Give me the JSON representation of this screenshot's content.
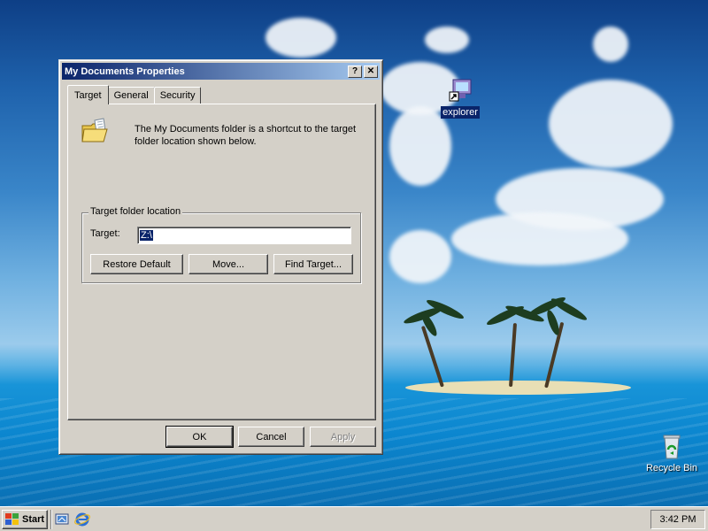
{
  "desktop": {
    "icons": [
      {
        "label": "explorer",
        "icon": "explorer-shortcut-icon",
        "selected": true
      },
      {
        "label": "Recycle Bin",
        "icon": "recycle-bin-icon",
        "selected": false
      }
    ]
  },
  "dialog": {
    "title": "My Documents Properties",
    "help_btn": "?",
    "close_btn": "✕",
    "tabs": [
      {
        "label": "Target",
        "active": true
      },
      {
        "label": "General",
        "active": false
      },
      {
        "label": "Security",
        "active": false
      }
    ],
    "description": "The My Documents folder is a shortcut to the target folder location shown below.",
    "group_label": "Target folder location",
    "target_label": "Target:",
    "target_value": "Z:\\",
    "buttons": {
      "restore_default": "Restore Default",
      "move": "Move...",
      "find_target": "Find Target...",
      "ok": "OK",
      "cancel": "Cancel",
      "apply": "Apply"
    }
  },
  "taskbar": {
    "start_label": "Start",
    "quick_launch": [
      "show-desktop-icon",
      "internet-explorer-icon"
    ],
    "clock": "3:42 PM"
  },
  "colors": {
    "titlebar_start": "#0a246a",
    "titlebar_end": "#a6caf0",
    "window_face": "#d4d0c8",
    "selection": "#0a246a"
  }
}
